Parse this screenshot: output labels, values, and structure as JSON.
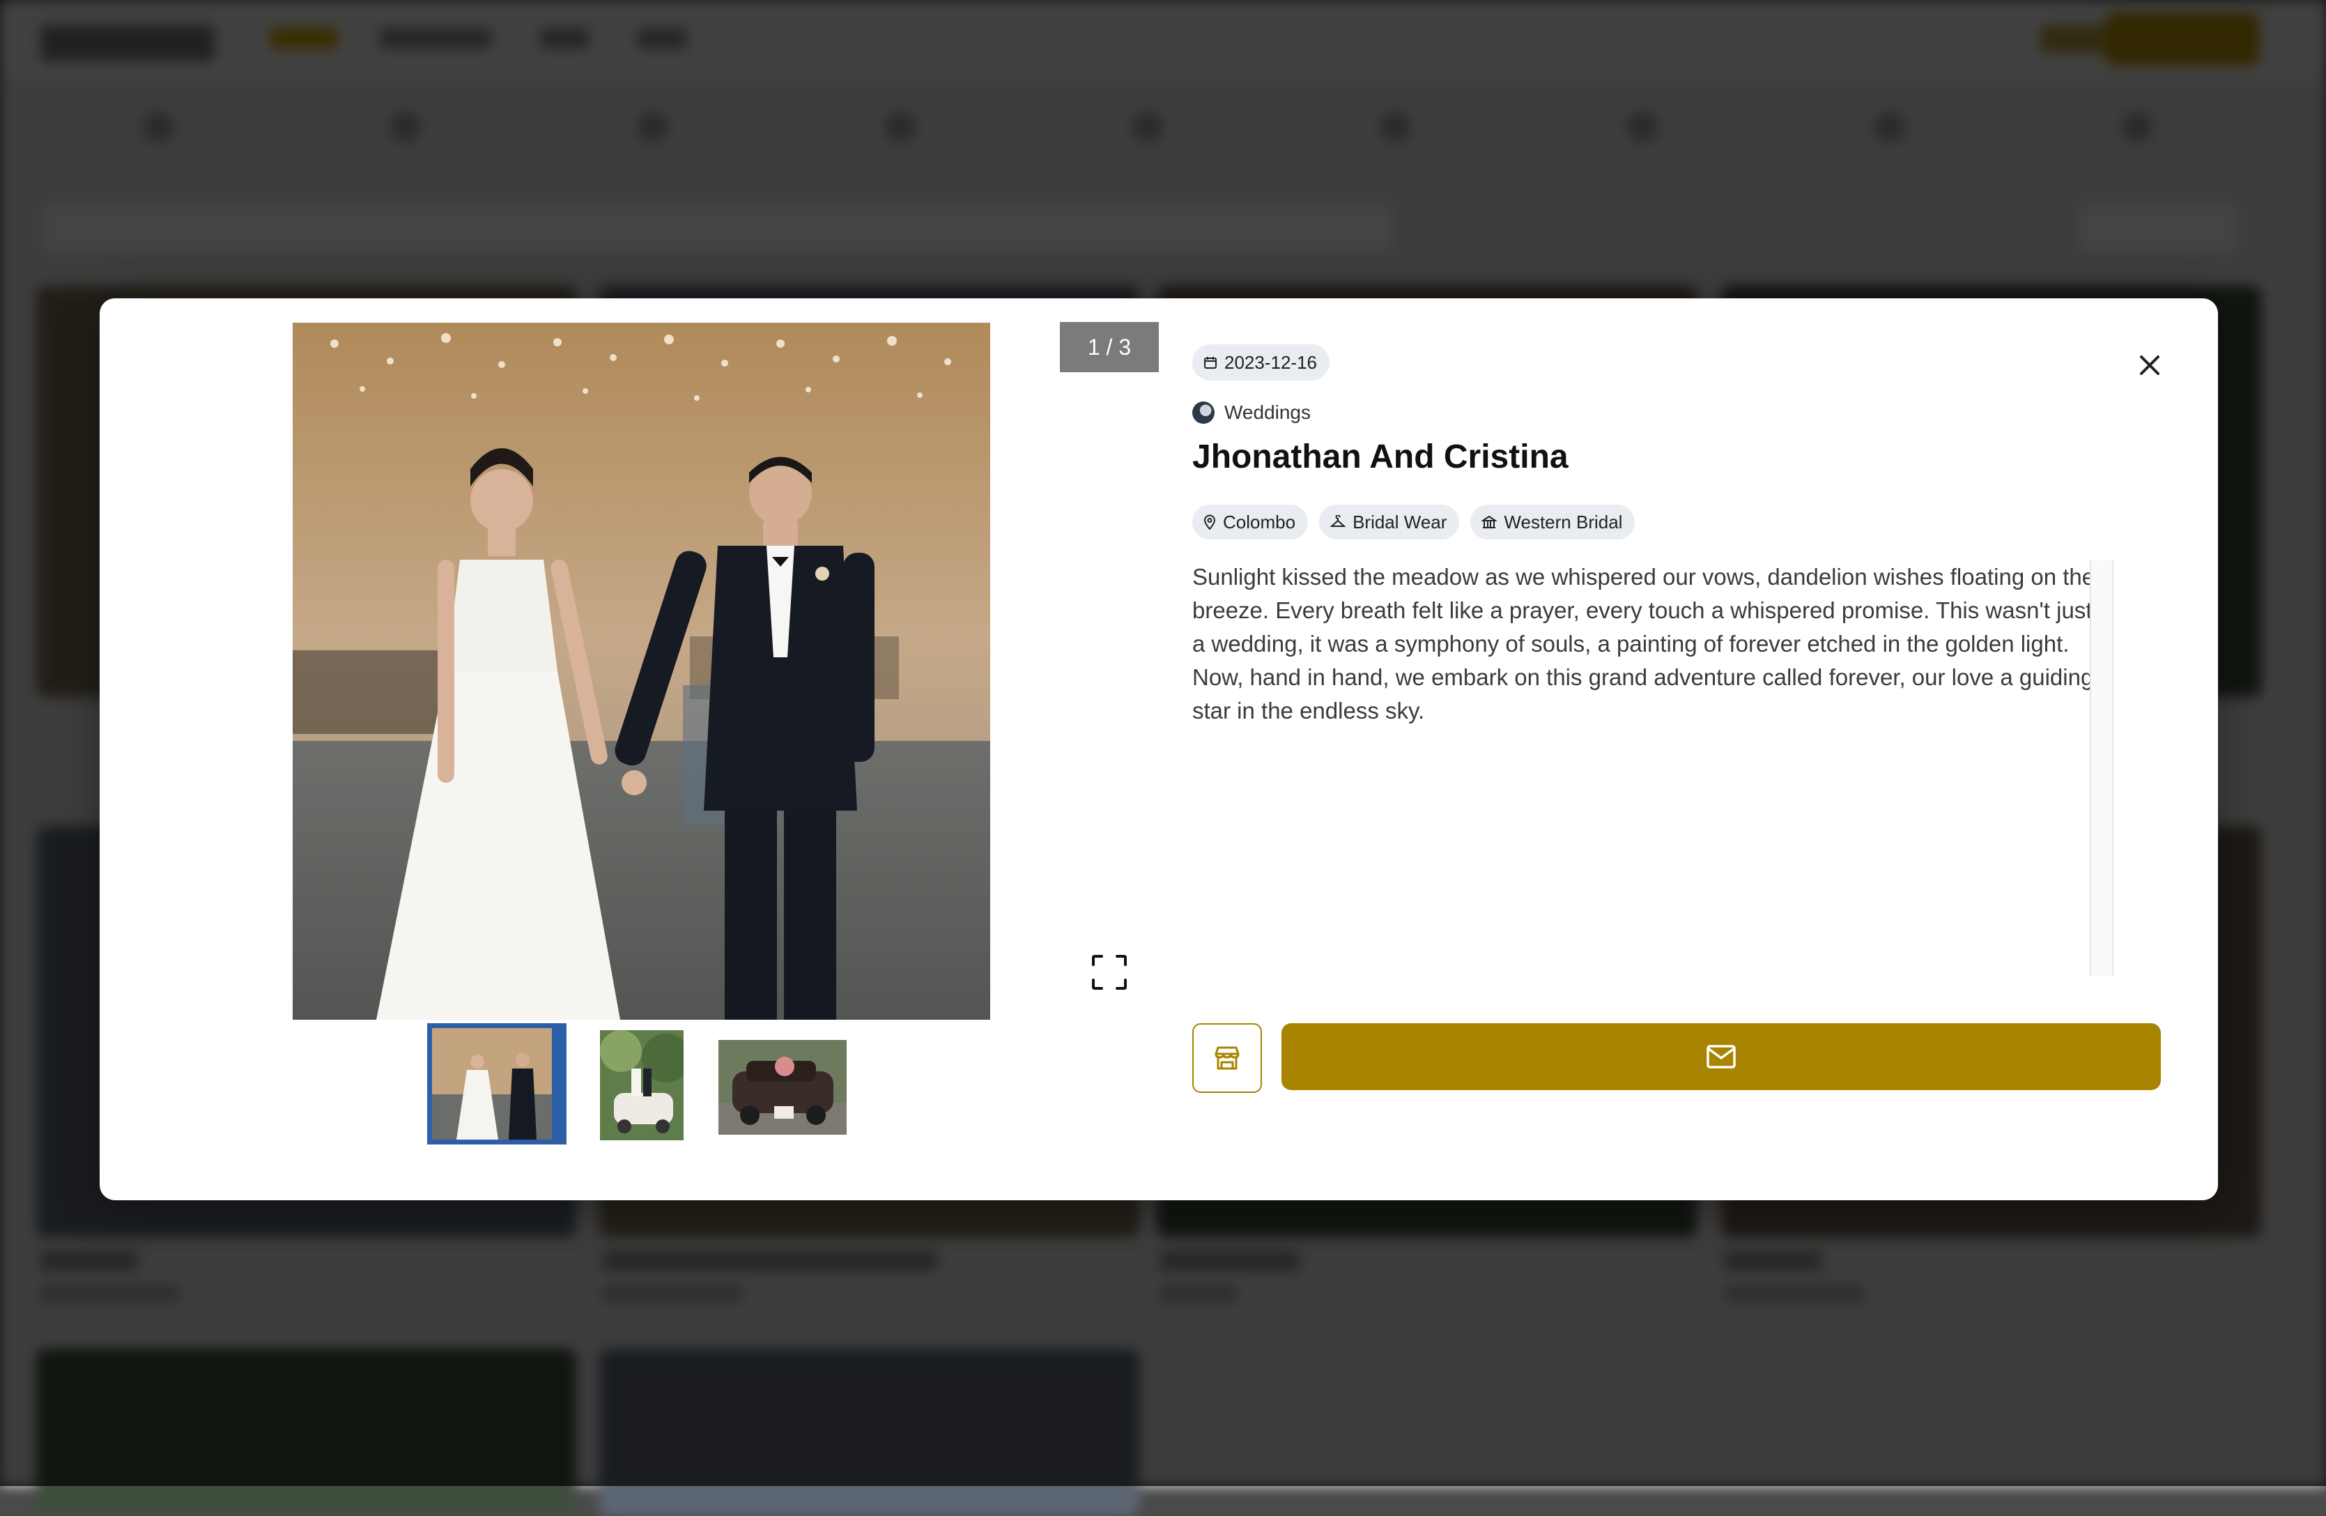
{
  "colors": {
    "accent": "#a88400",
    "thumb_selected": "#2d5fa8",
    "chip_bg": "#e9ecf1",
    "counter_bg": "#7b7b7b"
  },
  "gallery": {
    "counter": "1 / 3",
    "main_image": "bride-and-groom-walking-holding-hands",
    "thumbnails": [
      {
        "subject": "bride-and-groom-walking",
        "selected": true
      },
      {
        "subject": "couple-with-vintage-car-in-garden",
        "selected": false
      },
      {
        "subject": "vintage-car-with-bouquet",
        "selected": false
      }
    ],
    "expand_icon": "fullscreen-icon"
  },
  "post": {
    "date": "2023-12-16",
    "date_icon": "calendar-icon",
    "category": "Weddings",
    "title": "Jhonathan And Cristina",
    "tags": [
      {
        "icon": "location-pin-icon",
        "label": "Colombo"
      },
      {
        "icon": "hanger-icon",
        "label": "Bridal Wear"
      },
      {
        "icon": "building-icon",
        "label": "Western Bridal"
      }
    ],
    "description": "Sunlight kissed the meadow as we whispered our vows, dandelion wishes floating on the breeze. Every breath felt like a prayer, every touch a whispered promise. This wasn't just a wedding, it was a symphony of souls, a painting of forever etched in the golden light. Now, hand in hand, we embark on this grand adventure called forever, our love a guiding star in the endless sky."
  },
  "actions": {
    "close_icon": "close-icon",
    "store_icon": "store-icon",
    "mail_icon": "mail-icon"
  }
}
